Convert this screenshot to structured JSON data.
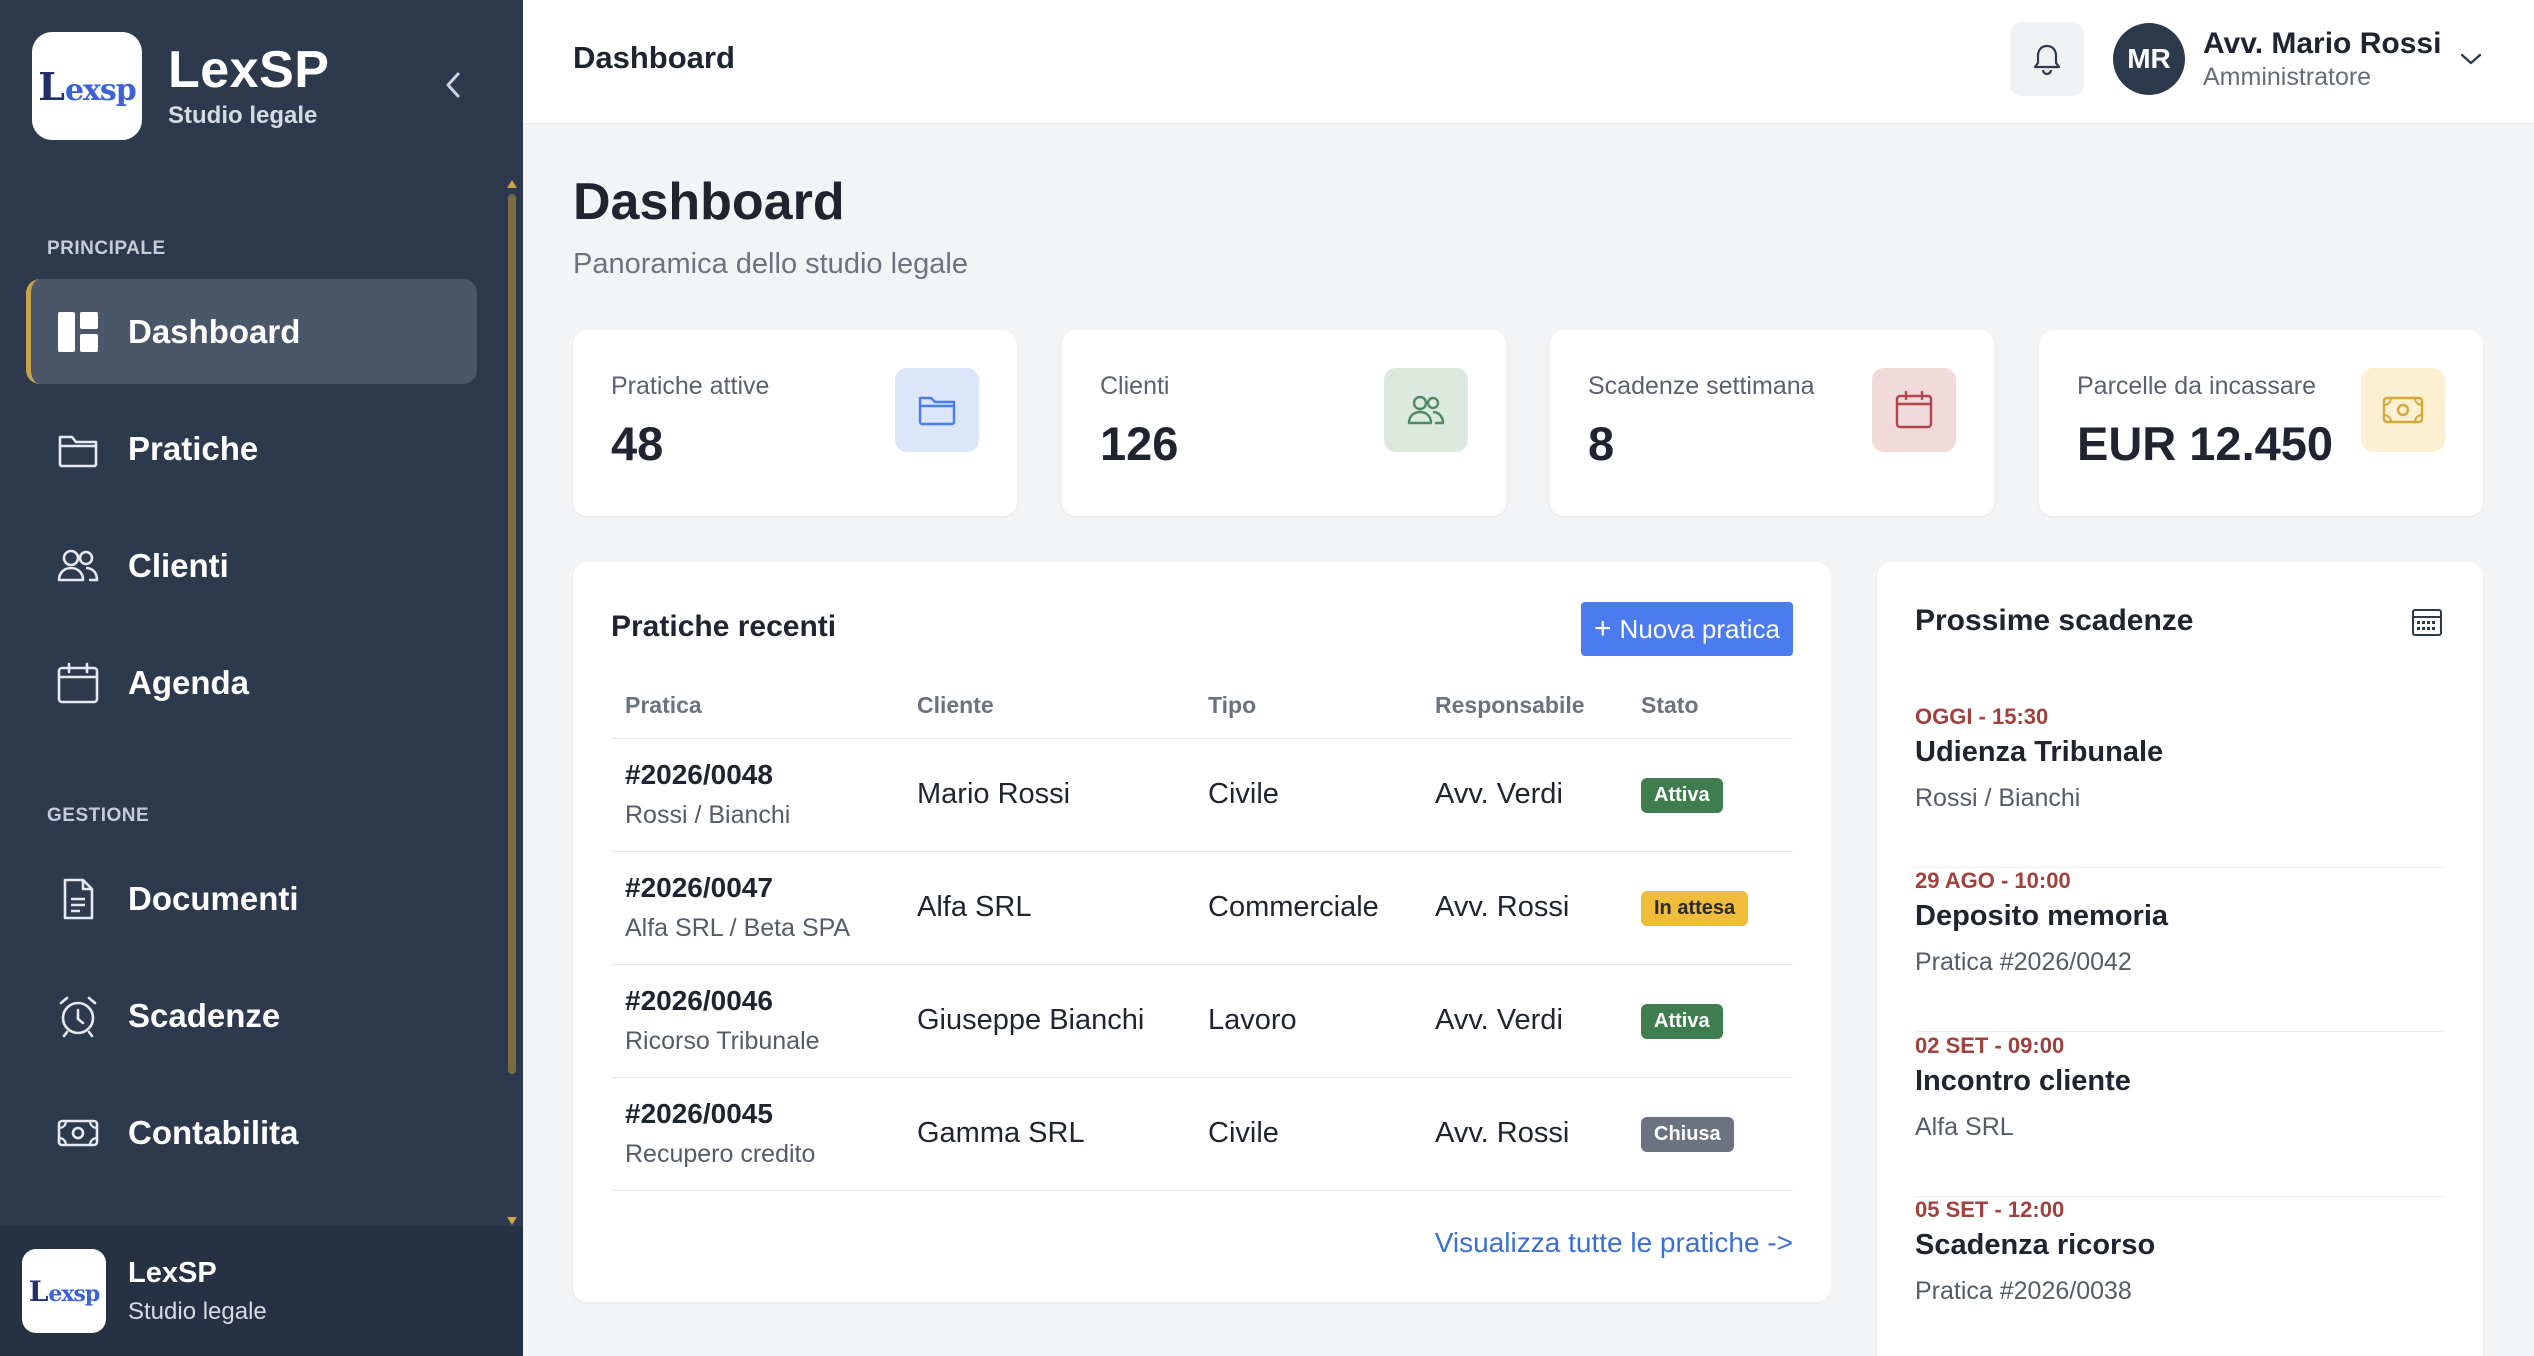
{
  "sidebar": {
    "brand_name": "LexSP",
    "brand_sub": "Studio legale",
    "logo_text_a": "L",
    "logo_text_b": "exsp",
    "sections": {
      "principale": "PRINCIPALE",
      "gestione": "GESTIONE"
    },
    "items": [
      {
        "label": "Dashboard",
        "icon": "dashboard-icon",
        "active": true
      },
      {
        "label": "Pratiche",
        "icon": "folder-icon"
      },
      {
        "label": "Clienti",
        "icon": "users-icon"
      },
      {
        "label": "Agenda",
        "icon": "calendar-icon"
      },
      {
        "label": "Documenti",
        "icon": "document-icon"
      },
      {
        "label": "Scadenze",
        "icon": "alarm-clock-icon"
      },
      {
        "label": "Contabilita",
        "icon": "cash-icon"
      }
    ],
    "footer": {
      "name": "LexSP",
      "sub": "Studio legale"
    }
  },
  "topbar": {
    "title": "Dashboard",
    "user": {
      "initials": "MR",
      "name": "Avv. Mario Rossi",
      "role": "Amministratore"
    }
  },
  "main": {
    "title": "Dashboard",
    "subtitle": "Panoramica dello studio legale",
    "stats": [
      {
        "label": "Pratiche attive",
        "value": "48",
        "icon": "folder-icon",
        "color": "#4a7cf0",
        "bg": "#dbe6fb"
      },
      {
        "label": "Clienti",
        "value": "126",
        "icon": "users-icon",
        "color": "#4f8a64",
        "bg": "#dbe9df"
      },
      {
        "label": "Scadenze settimana",
        "value": "8",
        "icon": "calendar-icon",
        "color": "#b0454a",
        "bg": "#f2d9da"
      },
      {
        "label": "Parcelle da incassare",
        "value": "EUR 12.450",
        "icon": "cash-icon",
        "color": "#d4a73a",
        "bg": "#fbf0d2"
      }
    ],
    "recent": {
      "title": "Pratiche recenti",
      "new_button": "Nuova pratica",
      "columns": [
        "Pratica",
        "Cliente",
        "Tipo",
        "Responsabile",
        "Stato"
      ],
      "rows": [
        {
          "num": "#2026/0048",
          "desc": "Rossi / Bianchi",
          "client": "Mario Rossi",
          "type": "Civile",
          "owner": "Avv. Verdi",
          "status": "Attiva",
          "status_color": "#3f7d4e"
        },
        {
          "num": "#2026/0047",
          "desc": "Alfa SRL / Beta SPA",
          "client": "Alfa SRL",
          "type": "Commerciale",
          "owner": "Avv. Rossi",
          "status": "In attesa",
          "status_color": "#efbd3a"
        },
        {
          "num": "#2026/0046",
          "desc": "Ricorso Tribunale",
          "client": "Giuseppe Bianchi",
          "type": "Lavoro",
          "owner": "Avv. Verdi",
          "status": "Attiva",
          "status_color": "#3f7d4e"
        },
        {
          "num": "#2026/0045",
          "desc": "Recupero credito",
          "client": "Gamma SRL",
          "type": "Civile",
          "owner": "Avv. Rossi",
          "status": "Chiusa",
          "status_color": "#6b7280"
        }
      ],
      "view_all": "Visualizza tutte le pratiche ->"
    },
    "deadlines": {
      "title": "Prossime scadenze",
      "items": [
        {
          "when": "OGGI - 15:30",
          "title": "Udienza Tribunale",
          "sub": "Rossi / Bianchi"
        },
        {
          "when": "29 AGO - 10:00",
          "title": "Deposito memoria",
          "sub": "Pratica #2026/0042"
        },
        {
          "when": "02 SET - 09:00",
          "title": "Incontro cliente",
          "sub": "Alfa SRL"
        },
        {
          "when": "05 SET - 12:00",
          "title": "Scadenza ricorso",
          "sub": "Pratica #2026/0038"
        }
      ]
    }
  }
}
